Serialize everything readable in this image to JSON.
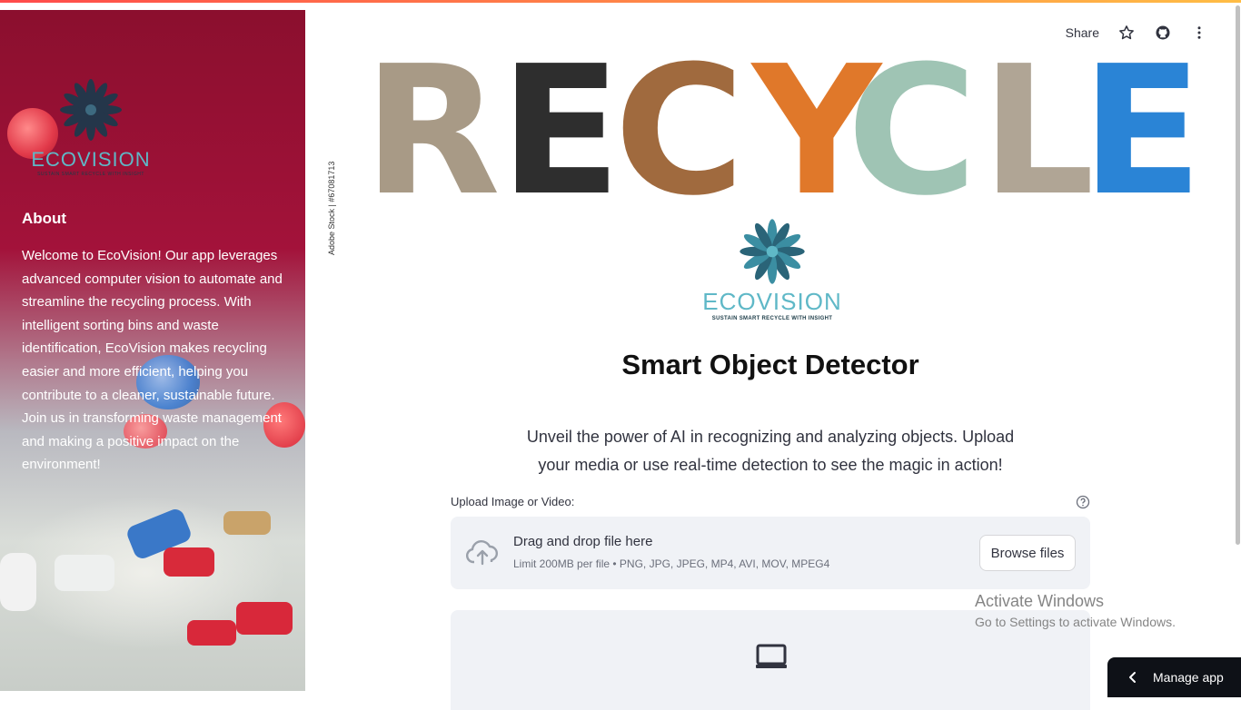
{
  "header": {
    "share_label": "Share"
  },
  "sidebar": {
    "logo": {
      "name": "ECOVISION",
      "tagline": "SUSTAIN SMART RECYCLE WITH INSIGHT"
    },
    "about_title": "About",
    "about_text": "Welcome to EcoVision! Our app leverages advanced computer vision to automate and streamline the recycling process. With intelligent sorting bins and waste identification, EcoVision makes recycling easier and more efficient, helping you contribute to a cleaner, sustainable future. Join us in transforming waste management and making a positive impact on the environment!"
  },
  "banner": {
    "letters": [
      "R",
      "E",
      "C",
      "Y",
      "C",
      "L",
      "E"
    ],
    "stock_credit": "Adobe Stock | #67081713"
  },
  "main": {
    "logo": {
      "name": "ECOVISION",
      "tagline": "SUSTAIN SMART RECYCLE WITH INSIGHT"
    },
    "title": "Smart Object Detector",
    "description": "Unveil the power of AI in recognizing and analyzing objects. Upload your media or use real-time detection to see the magic in action!"
  },
  "uploader": {
    "label": "Upload Image or Video:",
    "drag_text": "Drag and drop file here",
    "limit_text": "Limit 200MB per file • PNG, JPG, JPEG, MP4, AVI, MOV, MPEG4",
    "browse_label": "Browse files"
  },
  "watermark": {
    "title": "Activate Windows",
    "subtitle": "Go to Settings to activate Windows."
  },
  "manage_app": {
    "label": "Manage app"
  },
  "colors": {
    "accent_teal": "#5fb8c7",
    "sidebar_red": "#a3123a",
    "dark": "#0e1117"
  },
  "icons": [
    "star-icon",
    "github-icon",
    "more-vertical-icon",
    "help-icon",
    "cloud-upload-icon",
    "laptop-icon",
    "chevron-left-icon"
  ]
}
